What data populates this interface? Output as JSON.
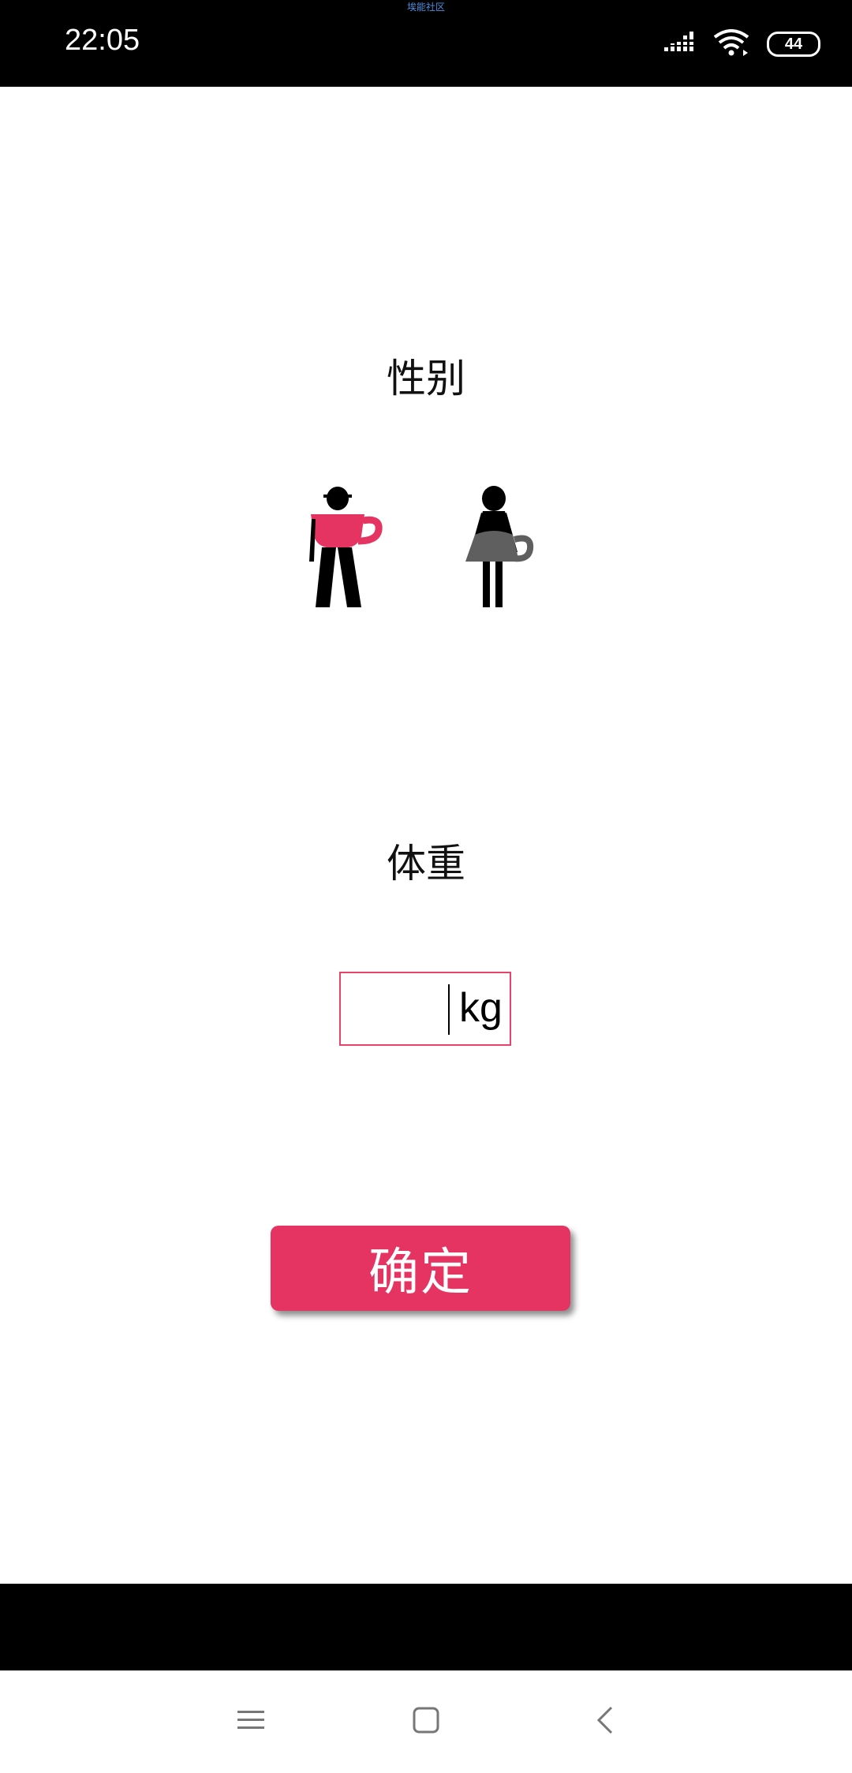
{
  "status_bar": {
    "time": "22:05",
    "notice": "埃能社区",
    "battery": "44"
  },
  "gender": {
    "title": "性别",
    "options": [
      {
        "name": "male",
        "icon": "male-teacup-figure-icon",
        "color": "#e63462"
      },
      {
        "name": "female",
        "icon": "female-teacup-figure-icon",
        "color": "#5f5f5f"
      }
    ]
  },
  "weight": {
    "title": "体重",
    "value": "",
    "unit": "kg",
    "border_color": "#e8436d"
  },
  "confirm": {
    "label": "确定",
    "color": "#e63462"
  },
  "nav": {
    "icons": [
      "menu-icon",
      "home-icon",
      "back-icon"
    ]
  }
}
